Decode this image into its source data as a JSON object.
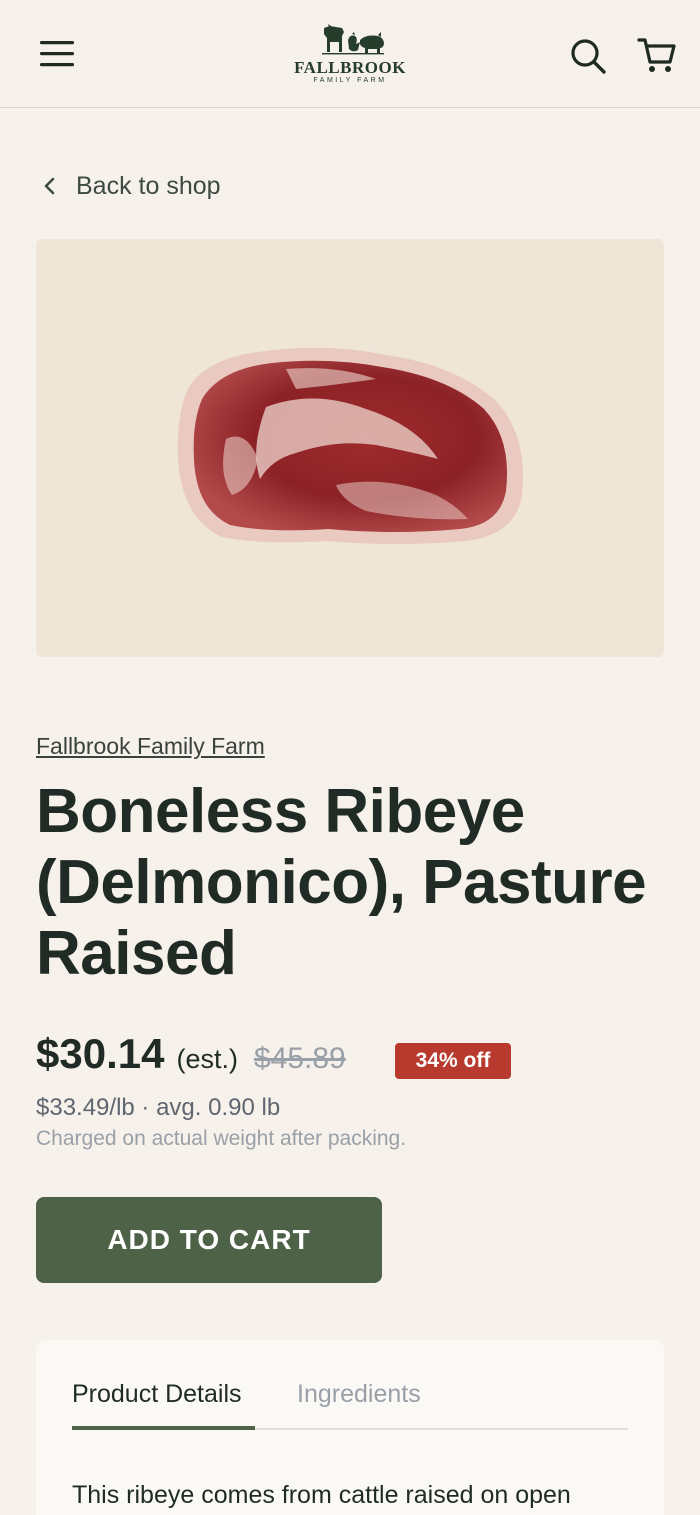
{
  "header": {
    "logo_name": "FALLBROOK",
    "logo_sub": "FAMILY FARM",
    "icons": [
      "hamburger-menu-icon",
      "search-icon",
      "cart-icon"
    ]
  },
  "nav": {
    "back_label": "Back to shop"
  },
  "product": {
    "brand": "Fallbrook Family Farm",
    "title": "Boneless Ribeye (Delmonico), Pasture Raised",
    "price": "$30.14",
    "price_est": "(est.)",
    "original_price": "$45.89",
    "discount_badge": "34% off",
    "unit_price": "$33.49/lb · avg. 0.90 lb",
    "weight_note": "Charged on actual weight after packing.",
    "add_to_cart_label": "ADD TO CART"
  },
  "details": {
    "tabs": [
      {
        "label": "Product Details",
        "active": true
      },
      {
        "label": "Ingredients",
        "active": false
      }
    ],
    "description": "This ribeye comes from cattle raised on open"
  },
  "colors": {
    "background": "#f6f1ea",
    "accent_green": "#4e6248",
    "badge_red": "#b83a2e",
    "image_bg": "#efe6d8"
  }
}
